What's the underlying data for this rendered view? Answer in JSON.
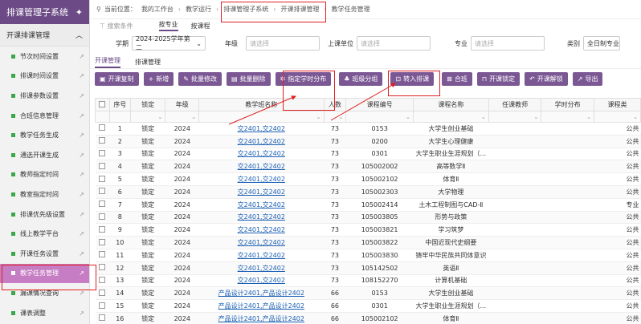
{
  "sidebar": {
    "title": "排课管理子系统",
    "group": "开课排课管理",
    "items": [
      {
        "label": "节次时间设置"
      },
      {
        "label": "排课时间设置"
      },
      {
        "label": "排课参数设置"
      },
      {
        "label": "合班信息管理"
      },
      {
        "label": "教学任务生成"
      },
      {
        "label": "通选开课生成"
      },
      {
        "label": "教师指定时间"
      },
      {
        "label": "教室指定时间"
      },
      {
        "label": "排课优先级设置"
      },
      {
        "label": "线上教学平台"
      },
      {
        "label": "开课任务设置"
      },
      {
        "label": "教学任务管理"
      },
      {
        "label": "漏课情况查询"
      },
      {
        "label": "课表调整"
      }
    ],
    "active_index": 11
  },
  "breadcrumb": {
    "prefix": "当前位置：",
    "items": [
      "我的工作台",
      "教学运行",
      "排课管理子系统",
      "开课排课管理",
      "教学任务管理"
    ]
  },
  "filter_tabs": {
    "search_label": "搜索条件",
    "tab1": "按专业",
    "tab2": "按课程"
  },
  "filters": {
    "xueqi_label": "学期",
    "xueqi_value": "2024-2025学年第二",
    "nianji_label": "年级",
    "nianji_placeholder": "请选择",
    "shangke_label": "上课单位",
    "shangke_placeholder": "请选择",
    "zhuanye_label": "专业",
    "zhuanye_placeholder": "请选择",
    "leibie_label": "类别",
    "leibie_value": "全日制专业"
  },
  "subtabs": {
    "tab1": "开课管理",
    "tab2": "排课管理"
  },
  "toolbar": {
    "b1": "开课复制",
    "b2": "新增",
    "b3": "批量修改",
    "b4": "批量删除",
    "b5": "指定学时分布",
    "b6": "班级分组",
    "b7": "转入排课",
    "b8": "合班",
    "b9": "开课锁定",
    "b10": "开课解锁",
    "b11": "导出"
  },
  "table": {
    "headers": [
      "序号",
      "锁定",
      "年级",
      "教学班名称",
      "人数",
      "课程编号",
      "课程名称",
      "任课教师",
      "学时分布",
      "课程类"
    ],
    "rows": [
      {
        "no": "1",
        "lock": "锁定",
        "grade": "2024",
        "cls": "交2401,交2402",
        "num": "73",
        "code": "0153",
        "course": "大学生创业基础",
        "type": "公共"
      },
      {
        "no": "2",
        "lock": "锁定",
        "grade": "2024",
        "cls": "交2401,交2402",
        "num": "73",
        "code": "0200",
        "course": "大学生心理健康",
        "type": "公共"
      },
      {
        "no": "3",
        "lock": "锁定",
        "grade": "2024",
        "cls": "交2401,交2402",
        "num": "73",
        "code": "0301",
        "course": "大学生职业生涯规划（...",
        "type": "公共"
      },
      {
        "no": "4",
        "lock": "锁定",
        "grade": "2024",
        "cls": "交2401,交2402",
        "num": "73",
        "code": "105002002",
        "course": "高等数学Ⅱ",
        "type": "公共"
      },
      {
        "no": "5",
        "lock": "锁定",
        "grade": "2024",
        "cls": "交2401,交2402",
        "num": "73",
        "code": "105002102",
        "course": "体育Ⅱ",
        "type": "公共"
      },
      {
        "no": "6",
        "lock": "锁定",
        "grade": "2024",
        "cls": "交2401,交2402",
        "num": "73",
        "code": "105002303",
        "course": "大学物理",
        "type": "公共"
      },
      {
        "no": "7",
        "lock": "锁定",
        "grade": "2024",
        "cls": "交2401,交2402",
        "num": "73",
        "code": "105002414",
        "course": "土木工程制图与CAD-Ⅱ",
        "type": "专业"
      },
      {
        "no": "8",
        "lock": "锁定",
        "grade": "2024",
        "cls": "交2401,交2402",
        "num": "73",
        "code": "105003805",
        "course": "形势与政策",
        "type": "公共"
      },
      {
        "no": "9",
        "lock": "锁定",
        "grade": "2024",
        "cls": "交2401,交2402",
        "num": "73",
        "code": "105003821",
        "course": "学习筑梦",
        "type": "公共"
      },
      {
        "no": "10",
        "lock": "锁定",
        "grade": "2024",
        "cls": "交2401,交2402",
        "num": "73",
        "code": "105003822",
        "course": "中国近现代史纲要",
        "type": "公共"
      },
      {
        "no": "11",
        "lock": "锁定",
        "grade": "2024",
        "cls": "交2401,交2402",
        "num": "73",
        "code": "105003830",
        "course": "铸牢中华民族共同体意识",
        "type": "公共"
      },
      {
        "no": "12",
        "lock": "锁定",
        "grade": "2024",
        "cls": "交2401,交2402",
        "num": "73",
        "code": "105142502",
        "course": "英语Ⅱ",
        "type": "公共"
      },
      {
        "no": "13",
        "lock": "锁定",
        "grade": "2024",
        "cls": "交2401,交2402",
        "num": "73",
        "code": "108152270",
        "course": "计算机基础",
        "type": "公共"
      },
      {
        "no": "14",
        "lock": "锁定",
        "grade": "2024",
        "cls": "产品设计2401,产品设计2402",
        "num": "66",
        "code": "0153",
        "course": "大学生创业基础",
        "type": "公共"
      },
      {
        "no": "15",
        "lock": "锁定",
        "grade": "2024",
        "cls": "产品设计2401,产品设计2402",
        "num": "66",
        "code": "0301",
        "course": "大学生职业生涯规划（...",
        "type": "公共"
      },
      {
        "no": "16",
        "lock": "锁定",
        "grade": "2024",
        "cls": "产品设计2401,产品设计2402",
        "num": "66",
        "code": "105002102",
        "course": "体育Ⅱ",
        "type": "公共"
      }
    ]
  },
  "colors": {
    "purple": "#6b4a86",
    "button": "#7b5894",
    "active": "#c77dc3",
    "highlight": "#e02020"
  }
}
